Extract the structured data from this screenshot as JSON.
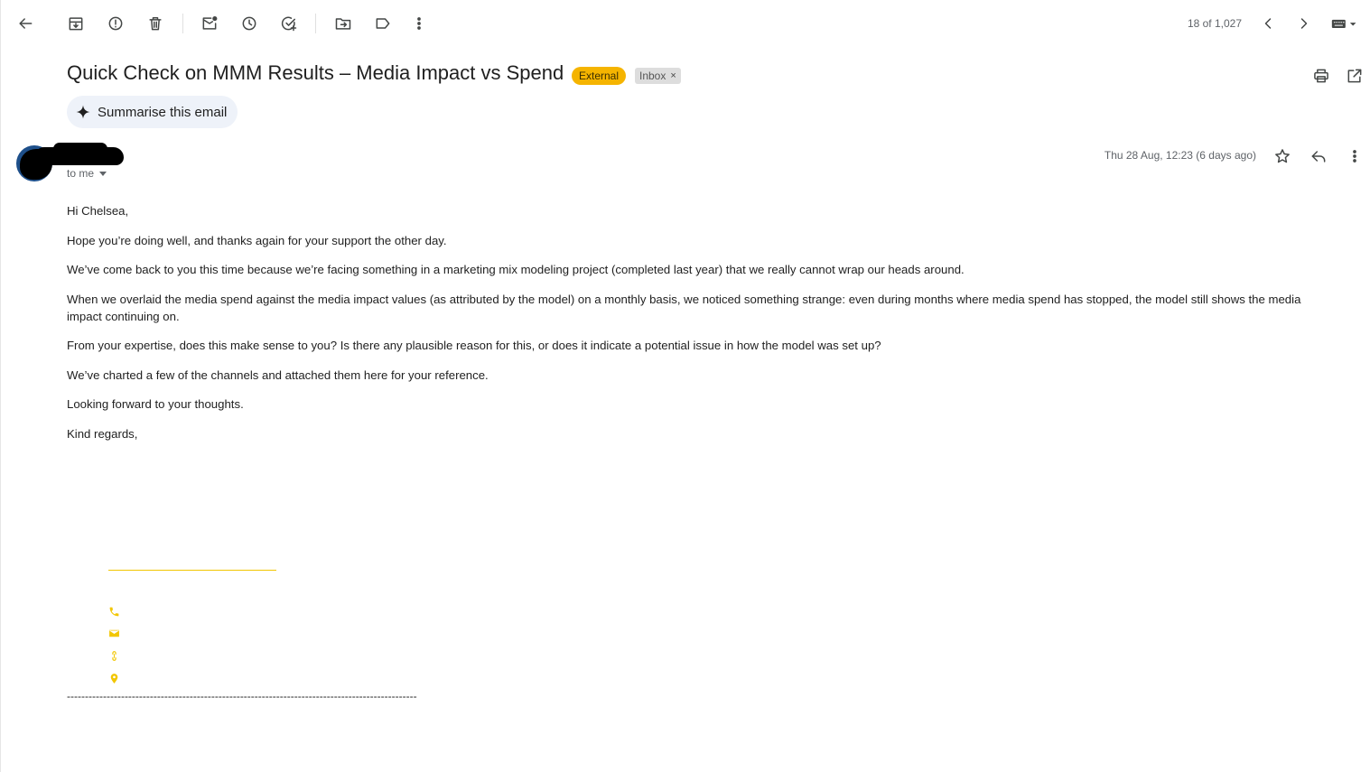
{
  "toolbar": {
    "page_count": "18 of 1,027"
  },
  "subject": {
    "title": "Quick Check on MMM Results – Media Impact vs Spend",
    "external_label": "External",
    "inbox_label": "Inbox",
    "inbox_remove": "×"
  },
  "summarise": {
    "label": "Summarise this email"
  },
  "message": {
    "recipient": "to me",
    "date": "Thu 28 Aug, 12:23 (6 days ago)",
    "paragraphs": [
      "Hi Chelsea,",
      "Hope you’re doing well, and thanks again for your support the other day.",
      "We’ve come back to you this time because we’re facing something in a marketing mix modeling project (completed last year) that we really cannot wrap our heads around.",
      "When we overlaid the media spend against the media impact values (as attributed by the model) on a monthly basis, we noticed something strange: even during months where media spend has stopped, the model still shows the media impact continuing on.",
      "From your expertise, does this make sense to you? Is there any plausible reason for this, or does it indicate a potential issue in how the model was set up?",
      "We’ve charted a few of the channels and attached them here for your reference.",
      "Looking forward to your thoughts.",
      "Kind regards,"
    ],
    "separator": "-------------------------------------------------------------------------------------------------"
  },
  "colors": {
    "external_chip": "#f5b400",
    "signature_accent": "#f2c600",
    "avatar": "#1e4f8a"
  },
  "icons": {
    "toolbar": [
      "back-arrow-icon",
      "archive-icon",
      "report-spam-icon",
      "delete-icon",
      "mark-unread-icon",
      "snooze-icon",
      "add-task-icon",
      "move-to-icon",
      "label-icon",
      "more-vert-icon"
    ],
    "signature": [
      "phone-icon",
      "mail-icon",
      "link-icon",
      "location-pin-icon"
    ]
  }
}
